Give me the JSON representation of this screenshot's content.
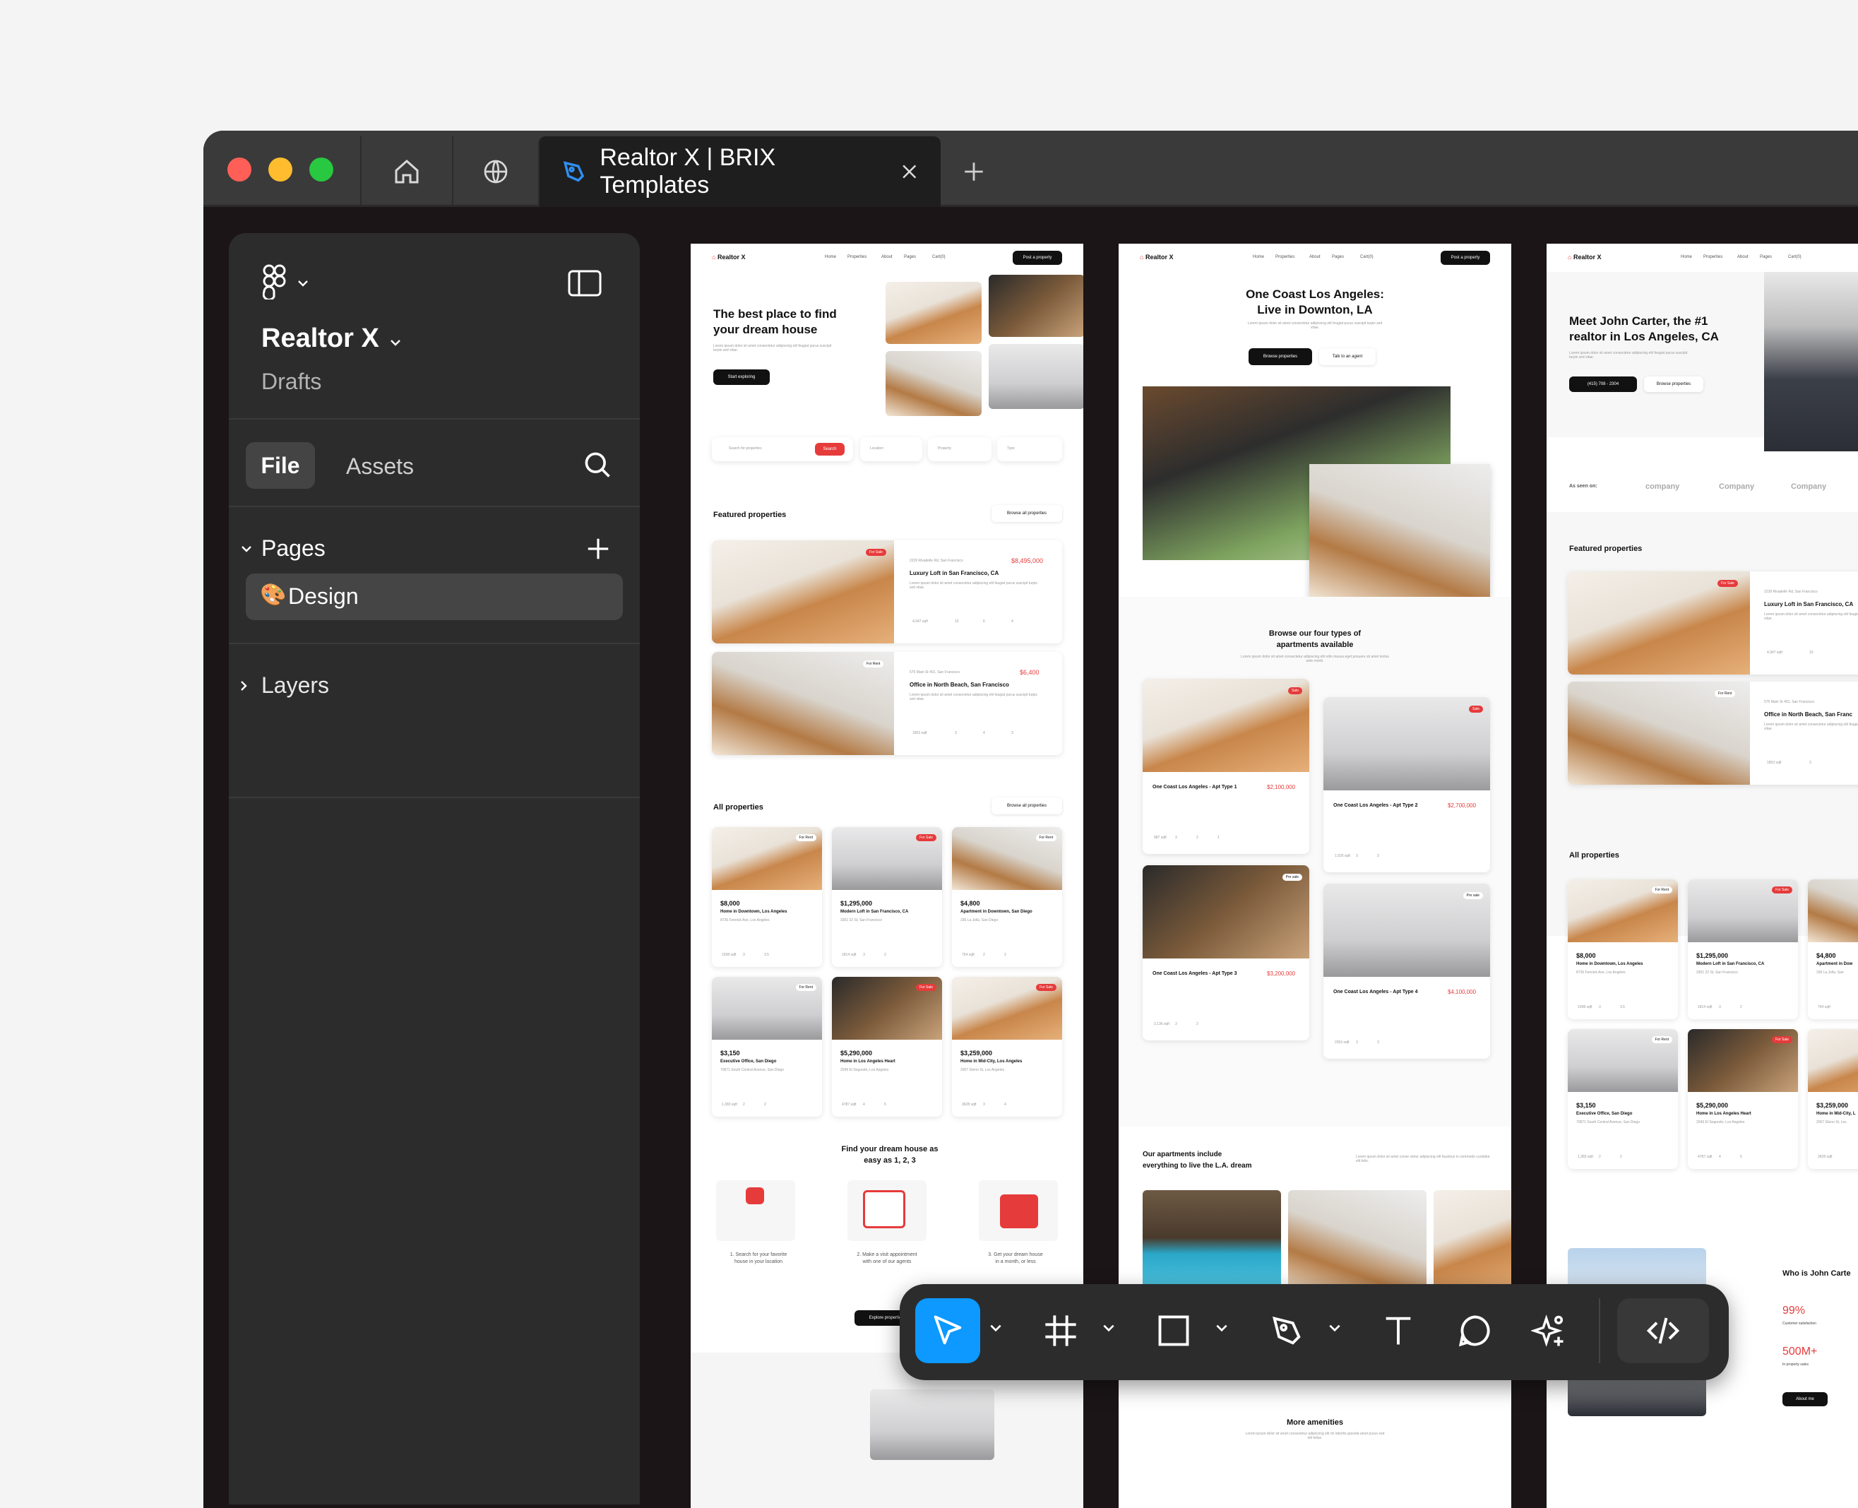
{
  "tabs": {
    "active_title": "Realtor X | BRIX Templates"
  },
  "sidebar": {
    "project_name": "Realtor X",
    "project_location": "Drafts",
    "file_tab": "File",
    "assets_tab": "Assets",
    "pages_label": "Pages",
    "page_item": "Design",
    "page_emoji": "🎨",
    "layers_label": "Layers"
  },
  "frame1": {
    "brand": "Realtor X",
    "nav": [
      "Home",
      "Properties",
      "About",
      "Pages",
      "Cart(0)"
    ],
    "cta": "Post a property",
    "hero_title_1": "The best place to find",
    "hero_title_2": "your dream house",
    "hero_desc": "Lorem ipsum dolor sit amet consectetur adipiscing elit feugiat purus suscipit turpis sed vitae.",
    "hero_btn": "Start exploring",
    "search_placeholder": "Search for properties",
    "search_btn": "Search",
    "filters": [
      "Location",
      "Property",
      "Type"
    ],
    "featured_title": "Featured properties",
    "browse_all": "Browse all properties",
    "featured": [
      {
        "badge": "For Sale",
        "address": "2239 Rivadelle Rd, San Francisco",
        "price": "$8,495,000",
        "title": "Luxury Loft in San Francisco, CA",
        "desc": "Lorem ipsum dolor sit amet consectetur adipiscing elit feugiat purus suscipit turpis sed vitae.",
        "specs": [
          "4,947 sqft",
          "10",
          "6",
          "4"
        ]
      },
      {
        "badge": "For Rent",
        "address": "575 Main St 401, San Francisco",
        "price": "$6,400",
        "title": "Office in North Beach, San Francisco",
        "desc": "Lorem ipsum dolor sit amet consectetur adipiscing elit feugiat purus suscipit turpis sed vitae.",
        "specs": [
          "1853 sqft",
          "3",
          "4",
          "3"
        ]
      }
    ],
    "all_title": "All properties",
    "all_browse": "Browse all properties",
    "all": [
      {
        "badge": "For Rent",
        "price": "$8,000",
        "title": "Home in Downtown, Los Angeles",
        "address": "8736 Fennick Ave, Los Angeles",
        "specs": [
          "1598 sqft",
          "3",
          "3.5"
        ]
      },
      {
        "badge": "For Sale",
        "price": "$1,295,000",
        "title": "Modern Loft in San Francisco, CA",
        "address": "3301 22 St, San Francisco",
        "specs": [
          "1814 sqft",
          "3",
          "2"
        ]
      },
      {
        "badge": "For Rent",
        "price": "$4,800",
        "title": "Apartment in Downtown, San Diego",
        "address": "336 La Jolla, San Diego",
        "specs": [
          "754 sqft",
          "2",
          "2"
        ]
      },
      {
        "badge": "For Rent",
        "price": "$3,150",
        "title": "Executive Office, San Diego",
        "address": "70871 South Central Avenue, San Diego",
        "specs": [
          "1,383 sqft",
          "2",
          "2"
        ]
      },
      {
        "badge": "For Sale",
        "price": "$5,290,000",
        "title": "Home in Los Angeles Heart",
        "address": "2049 El Segundo, Los Angeles",
        "specs": [
          "4787 sqft",
          "4",
          "5"
        ]
      },
      {
        "badge": "For Sale",
        "price": "$3,259,000",
        "title": "Home in Mid-City, Los Angeles",
        "address": "2007 Glenn St, Los Angeles",
        "specs": [
          "3628 sqft",
          "3",
          "4"
        ]
      }
    ],
    "steps_title_1": "Find your dream house as",
    "steps_title_2": "easy as 1, 2, 3",
    "steps": [
      {
        "l1": "1. Search for your favorite",
        "l2": "house in your location"
      },
      {
        "l1": "2. Make a visit appointment",
        "l2": "with one of our agents"
      },
      {
        "l1": "3. Get your dream house",
        "l2": "in a month, or less"
      }
    ],
    "steps_btn": "Explore properties"
  },
  "frame2": {
    "brand": "Realtor X",
    "nav": [
      "Home",
      "Properties",
      "About",
      "Pages",
      "Cart(0)"
    ],
    "cta": "Post a property",
    "hero_title_1": "One Coast Los Angeles:",
    "hero_title_2": "Live in Downton, LA",
    "hero_desc": "Lorem ipsum dolor sit amet consectetur adipiscing elit feugiat purus suscipit turpis sed vitae.",
    "btn_primary": "Browse properties",
    "btn_secondary": "Talk to an agent",
    "types_title_1": "Browse our four types of",
    "types_title_2": "apartments available",
    "types_desc": "Lorem ipsum dolor sit amet consectetur adipiscing elit odio massa eget posuere sit amet lectus ante morbi.",
    "types": [
      {
        "badge": "Sale",
        "title": "One Coast Los Angeles - Apt Type 1",
        "price": "$2,100,000",
        "specs": [
          "987 sqft",
          "3",
          "2",
          "1"
        ]
      },
      {
        "badge": "Sale",
        "title": "One Coast Los Angeles - Apt Type 2",
        "price": "$2,700,000",
        "specs": [
          "1,025 sqft",
          "3",
          "3"
        ]
      },
      {
        "badge": "Pre sale",
        "title": "One Coast Los Angeles - Apt Type 3",
        "price": "$3,200,000",
        "specs": [
          "2,136 sqft",
          "3",
          "2"
        ]
      },
      {
        "badge": "Pre sale",
        "title": "One Coast Los Angeles - Apt Type 4",
        "price": "$4,100,000",
        "specs": [
          "2353 sqft",
          "3",
          "3"
        ]
      }
    ],
    "amenities_title_1": "Our apartments include",
    "amenities_title_2": "everything to live the L.A. dream",
    "amenities_desc": "Lorem ipsum dolor sit amet conse ctetur adipiscing elit faucibus in commodo curabitur elit felis.",
    "more_title": "More amenities",
    "more_desc": "Lorem ipsum dolor sit amet consectetur adipiscing elit mi lobortis gravida amet purus sed elit tellus."
  },
  "frame3": {
    "brand": "Realtor X",
    "nav": [
      "Home",
      "Properties",
      "About",
      "Pages",
      "Cart(0)"
    ],
    "hero_title_1": "Meet John Carter, the #1",
    "hero_title_2": "realtor in Los Angeles, CA",
    "hero_desc": "Lorem ipsum dolor sit amet consectetur adipiscing elit feugiat purus suscipit turpis sed vitae.",
    "phone": "(415) 708 - 2304",
    "btn_secondary": "Browse properties",
    "seen_on": "As seen on:",
    "logos": [
      "company",
      "Company",
      "Company"
    ],
    "featured_title": "Featured properties",
    "featured": [
      {
        "badge": "For Sale",
        "address": "2239 Rivadelle Rd, San Francisco",
        "title": "Luxury Loft in San Francisco, CA",
        "desc": "Lorem ipsum dolor sit amet consectetur adipiscing elit feugiat purus suscipit turpis sed vitae.",
        "specs": [
          "4,947 sqft",
          "10"
        ]
      },
      {
        "badge": "For Rent",
        "address": "575 Main St 401, San Francisco",
        "title": "Office in North Beach, San Franc",
        "desc": "Lorem ipsum dolor sit amet consectetur adipiscing elit feugiat purus suscipit turpis sed vitae.",
        "specs": [
          "1853 sqft",
          "3"
        ]
      }
    ],
    "all_title": "All properties",
    "all": [
      {
        "badge": "For Rent",
        "price": "$8,000",
        "title": "Home in Downtown, Los Angeles",
        "address": "8736 Fennick Ave, Los Angeles",
        "specs": [
          "1598 sqft",
          "3",
          "3.5"
        ]
      },
      {
        "badge": "For Sale",
        "price": "$1,295,000",
        "title": "Modern Loft in San Francisco, CA",
        "address": "3301 22 St, San Francisco",
        "specs": [
          "1814 sqft",
          "3",
          "2"
        ]
      },
      {
        "badge": "",
        "price": "$4,800",
        "title": "Apartment in Dow",
        "address": "336 La Jolla, San",
        "specs": [
          "754 sqft"
        ]
      },
      {
        "badge": "For Rent",
        "price": "$3,150",
        "title": "Executive Office, San Diego",
        "address": "70871 South Central Avenue, San Diego",
        "specs": [
          "1,383 sqft",
          "2",
          "2"
        ]
      },
      {
        "badge": "For Sale",
        "price": "$5,290,000",
        "title": "Home in Los Angeles Heart",
        "address": "2049 El Segundo, Los Angeles",
        "specs": [
          "4787 sqft",
          "4",
          "5"
        ]
      },
      {
        "badge": "",
        "price": "$3,259,000",
        "title": "Home in Mid-City, L",
        "address": "2007 Glenn St, Los",
        "specs": [
          "3628 sqft"
        ]
      }
    ],
    "about_title": "Who is John Carte",
    "stat1_value": "99%",
    "stat1_label": "Customer satisfaction",
    "stat2_value": "500M+",
    "stat2_label": "In property sales",
    "about_btn": "About me"
  },
  "colors": {
    "accent": "#0d99ff",
    "brand_red": "#e63b3b",
    "panel": "#2c2c2c",
    "canvas": "#1b1517"
  },
  "toolbar": {
    "tools": [
      "move-tool",
      "frame-tool",
      "shape-tool",
      "pen-tool",
      "text-tool",
      "comment-tool",
      "actions-tool",
      "dev-mode-toggle"
    ]
  }
}
